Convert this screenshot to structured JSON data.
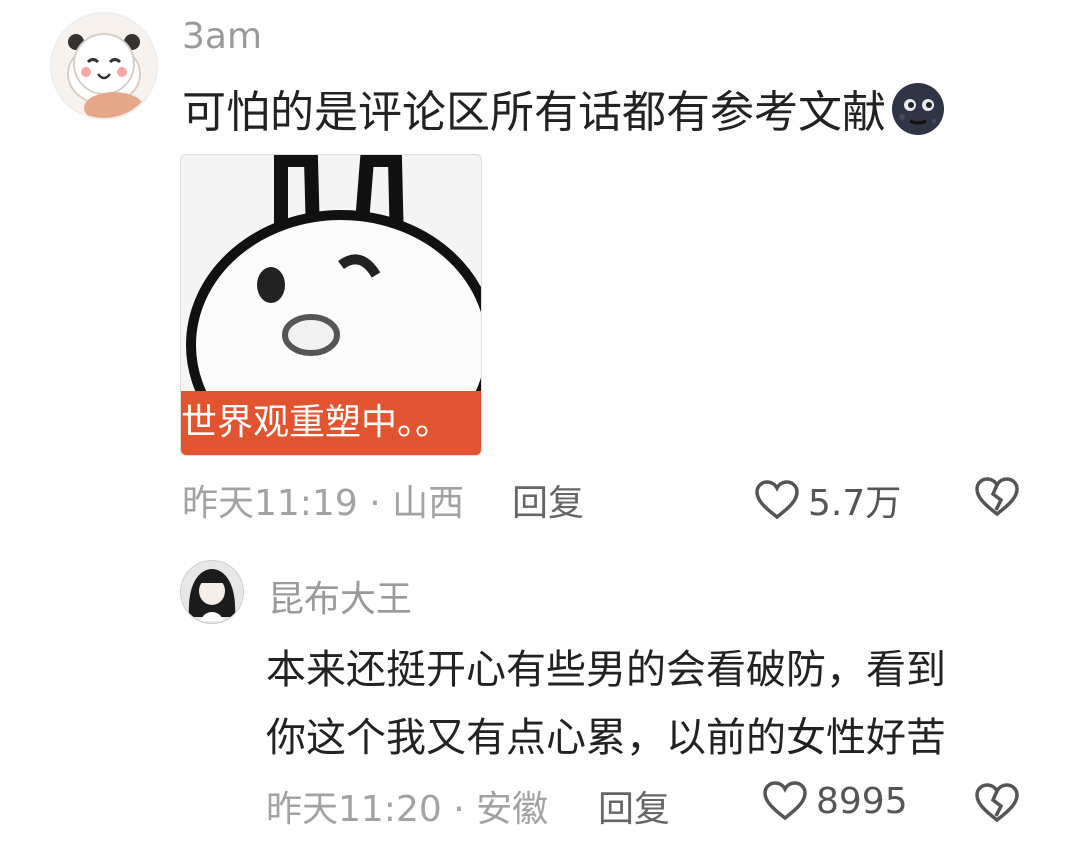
{
  "comment": {
    "username": "3am",
    "text": "可怕的是评论区所有话都有参考文献",
    "emoji": "new-moon-face",
    "sticker": {
      "caption": "世界观重塑中。。"
    },
    "meta": "昨天11:19 · 山西",
    "reply_label": "回复",
    "likes": "5.7万"
  },
  "reply": {
    "username": "昆布大王",
    "lines": [
      "本来还挺开心有些男的会看破防，看到",
      "你这个我又有点心累，以前的女性好苦"
    ],
    "meta": "昨天11:20 · 安徽",
    "reply_label": "回复",
    "likes": "8995"
  },
  "icons": {
    "like": "heart-outline-icon",
    "dislike": "broken-heart-icon"
  },
  "colors": {
    "sticker_banner": "#e2532f",
    "meta_text": "#a2a2a2"
  }
}
